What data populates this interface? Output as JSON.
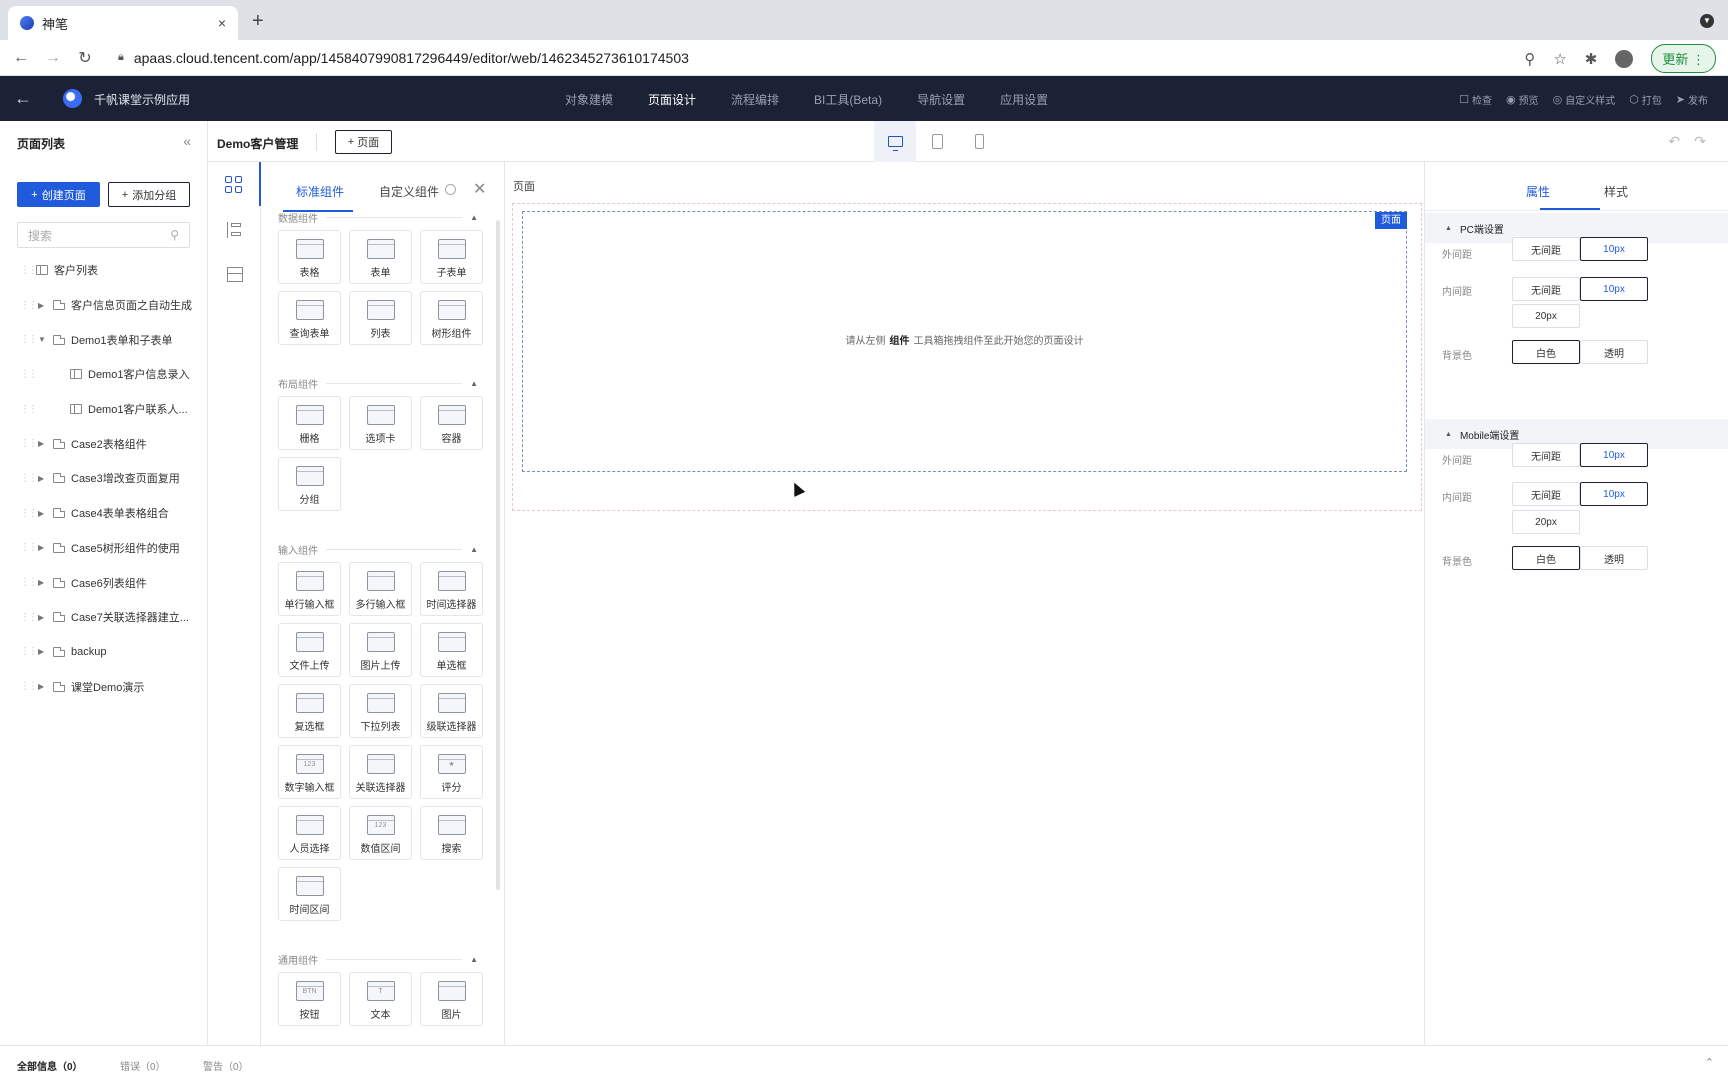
{
  "browser": {
    "tab_title": "神笔",
    "tab_close": "×",
    "new_tab": "+",
    "url": "apaas.cloud.tencent.com/app/1458407990817296449/editor/web/1462345273610174503",
    "update_label": "更新"
  },
  "header": {
    "app_name": "千帆课堂示例应用",
    "nav": [
      {
        "label": "对象建模",
        "active": false
      },
      {
        "label": "页面设计",
        "active": true
      },
      {
        "label": "流程编排",
        "active": false
      },
      {
        "label": "BI工具(Beta)",
        "active": false
      },
      {
        "label": "导航设置",
        "active": false
      },
      {
        "label": "应用设置",
        "active": false
      }
    ],
    "actions": [
      {
        "icon": "check-icon",
        "glyph": "☐",
        "label": "检查"
      },
      {
        "icon": "eye-icon",
        "glyph": "◉",
        "label": "预览"
      },
      {
        "icon": "style-icon",
        "glyph": "◎",
        "label": "自定义样式"
      },
      {
        "icon": "package-icon",
        "glyph": "⬡",
        "label": "打包"
      },
      {
        "icon": "publish-icon",
        "glyph": "➤",
        "label": "发布"
      }
    ]
  },
  "left_panel": {
    "title": "页面列表",
    "create_page": "创建页面",
    "add_group": "添加分组",
    "search_placeholder": "搜索",
    "tree": [
      {
        "label": "客户列表",
        "level": 0,
        "arrow": "",
        "type": "tbl"
      },
      {
        "label": "客户信息页面之自动生成",
        "level": 0,
        "arrow": "▶",
        "type": "doc"
      },
      {
        "label": "Demo1表单和子表单",
        "level": 0,
        "arrow": "▼",
        "type": "doc"
      },
      {
        "label": "Demo1客户信息录入",
        "level": 1,
        "arrow": "",
        "type": "tbl"
      },
      {
        "label": "Demo1客户联系人...",
        "level": 1,
        "arrow": "",
        "type": "tbl"
      },
      {
        "label": "Case2表格组件",
        "level": 0,
        "arrow": "▶",
        "type": "doc"
      },
      {
        "label": "Case3增改查页面复用",
        "level": 0,
        "arrow": "▶",
        "type": "doc"
      },
      {
        "label": "Case4表单表格组合",
        "level": 0,
        "arrow": "▶",
        "type": "doc"
      },
      {
        "label": "Case5树形组件的使用",
        "level": 0,
        "arrow": "▶",
        "type": "doc"
      },
      {
        "label": "Case6列表组件",
        "level": 0,
        "arrow": "▶",
        "type": "doc"
      },
      {
        "label": "Case7关联选择器建立...",
        "level": 0,
        "arrow": "▶",
        "type": "doc"
      },
      {
        "label": "backup",
        "level": 0,
        "arrow": "▶",
        "type": "doc"
      },
      {
        "label": "课堂Demo演示",
        "level": 0,
        "arrow": "▶",
        "type": "doc"
      }
    ]
  },
  "subbar": {
    "page_name": "Demo客户管理",
    "add_page": "页面"
  },
  "component_panel": {
    "tab_standard": "标准组件",
    "tab_custom": "自定义组件",
    "sections": [
      {
        "title": "数据组件",
        "items": [
          {
            "label": "表格",
            "glyph": ""
          },
          {
            "label": "表单",
            "glyph": ""
          },
          {
            "label": "子表单",
            "glyph": ""
          },
          {
            "label": "查询表单",
            "glyph": ""
          },
          {
            "label": "列表",
            "glyph": ""
          },
          {
            "label": "树形组件",
            "glyph": ""
          }
        ]
      },
      {
        "title": "布局组件",
        "items": [
          {
            "label": "栅格",
            "glyph": ""
          },
          {
            "label": "选项卡",
            "glyph": ""
          },
          {
            "label": "容器",
            "glyph": ""
          },
          {
            "label": "分组",
            "glyph": ""
          }
        ]
      },
      {
        "title": "输入组件",
        "items": [
          {
            "label": "单行输入框",
            "glyph": ""
          },
          {
            "label": "多行输入框",
            "glyph": ""
          },
          {
            "label": "时间选择器",
            "glyph": ""
          },
          {
            "label": "文件上传",
            "glyph": ""
          },
          {
            "label": "图片上传",
            "glyph": ""
          },
          {
            "label": "单选框",
            "glyph": ""
          },
          {
            "label": "复选框",
            "glyph": ""
          },
          {
            "label": "下拉列表",
            "glyph": ""
          },
          {
            "label": "级联选择器",
            "glyph": ""
          },
          {
            "label": "数字输入框",
            "glyph": "123"
          },
          {
            "label": "关联选择器",
            "glyph": ""
          },
          {
            "label": "评分",
            "glyph": "★"
          },
          {
            "label": "人员选择",
            "glyph": ""
          },
          {
            "label": "数值区间",
            "glyph": "123"
          },
          {
            "label": "搜索",
            "glyph": ""
          },
          {
            "label": "时间区间",
            "glyph": ""
          }
        ]
      },
      {
        "title": "通用组件",
        "items": [
          {
            "label": "按钮",
            "glyph": "BTN"
          },
          {
            "label": "文本",
            "glyph": "T"
          },
          {
            "label": "图片",
            "glyph": ""
          }
        ]
      }
    ]
  },
  "canvas": {
    "label": "页面",
    "tag": "页面",
    "hint_before": "请从左侧",
    "hint_bold": "组件",
    "hint_after": "工具箱拖拽组件至此开始您的页面设计"
  },
  "right_panel": {
    "tab_props": "属性",
    "tab_style": "样式",
    "pc_title": "PC端设置",
    "mobile_title": "Mobile端设置",
    "margin_label": "外间距",
    "padding_label": "内间距",
    "bg_label": "背景色",
    "opt_none": "无间距",
    "opt_10": "10px",
    "opt_20": "20px",
    "opt_white": "白色",
    "opt_transparent": "透明"
  },
  "status": {
    "all": "全部信息（0）",
    "errors": "错误（0）",
    "warnings": "警告（0）"
  }
}
